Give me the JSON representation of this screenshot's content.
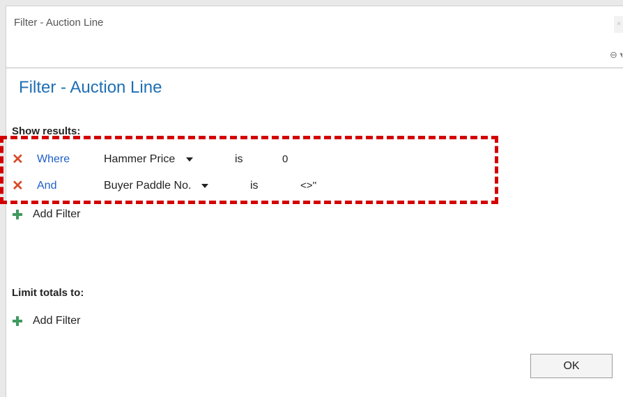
{
  "window": {
    "title": "Filter - Auction Line",
    "close_glyph": "×"
  },
  "toolbar": {
    "options_icon": "⊖ ▾"
  },
  "dialog": {
    "heading": "Filter - Auction Line"
  },
  "show_results": {
    "label": "Show results:",
    "filters": [
      {
        "operator": "Where",
        "field": "Hammer Price",
        "condition": "is",
        "value": "0"
      },
      {
        "operator": "And",
        "field": "Buyer Paddle No.",
        "condition": "is",
        "value": "<>''"
      }
    ],
    "add_filter_label": "Add Filter"
  },
  "limit_totals": {
    "label": "Limit totals to:",
    "add_filter_label": "Add Filter"
  },
  "buttons": {
    "ok_label": "OK"
  },
  "colors": {
    "heading": "#1f6fb5",
    "link": "#1d5fc8",
    "remove": "#d84a26",
    "add": "#3f9a5f",
    "highlight": "#d40000"
  }
}
